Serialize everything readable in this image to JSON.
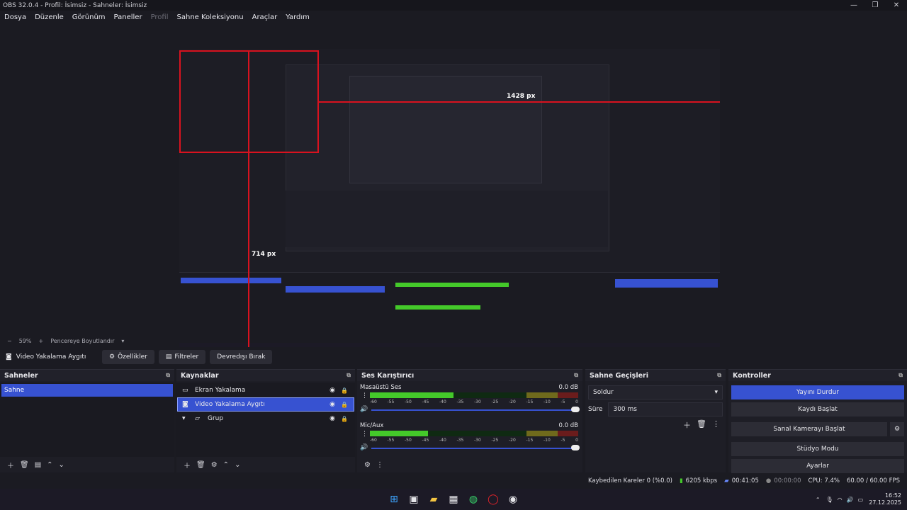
{
  "window": {
    "title": "OBS 32.0.4 - Profil: İsimsiz - Sahneler: İsimsiz",
    "minimize": "—",
    "maximize": "❐",
    "close": "✕"
  },
  "menu": {
    "items": [
      "Dosya",
      "Düzenle",
      "Görünüm",
      "Paneller",
      "Profil",
      "Sahne Koleksiyonu",
      "Araçlar",
      "Yardım"
    ]
  },
  "preview": {
    "label_1428": "1428 px",
    "label_714": "714 px",
    "zoom": "59%",
    "fit_label": "Pencereye Boyutlandır",
    "minus": "−",
    "plus": "+"
  },
  "source_toolbar": {
    "source_name": "Video Yakalama Aygıtı",
    "properties": "Özellikler",
    "filters": "Filtreler",
    "deactivate": "Devredışı Bırak"
  },
  "scenes": {
    "title": "Sahneler",
    "items": [
      "Sahne"
    ]
  },
  "sources": {
    "title": "Kaynaklar",
    "items": [
      "Ekran Yakalama",
      "Video Yakalama Aygıtı",
      "Grup"
    ]
  },
  "mixer": {
    "title": "Ses Karıştırıcı",
    "channels": [
      {
        "name": "Masaüstü Ses",
        "db": "0.0 dB",
        "level_fraction": 0.4
      },
      {
        "name": "Mic/Aux",
        "db": "0.0 dB",
        "level_fraction": 0.28
      }
    ],
    "ticks": [
      "-60",
      "-55",
      "-50",
      "-45",
      "-40",
      "-35",
      "-30",
      "-25",
      "-20",
      "-15",
      "-10",
      "-5",
      "0"
    ]
  },
  "transitions": {
    "title": "Sahne Geçişleri",
    "selected": "Soldur",
    "duration_label": "Süre",
    "duration_value": "300 ms"
  },
  "controls": {
    "title": "Kontroller",
    "buttons": [
      "Yayını Durdur",
      "Kaydı Başlat",
      "Sanal Kamerayı Başlat",
      "Stüdyo Modu",
      "Ayarlar"
    ]
  },
  "status": {
    "dropped": "Kaybedilen Kareler 0 (%0.0)",
    "bitrate": "6205 kbps",
    "stream_time": "00:41:05",
    "record_time": "00:00:00",
    "cpu": "CPU: 7.4%",
    "fps": "60.00 / 60.00 FPS"
  },
  "taskbar": {
    "time": "16:52",
    "date": "27.12.2025"
  },
  "colors": {
    "accent": "#3752d1",
    "background": "#1b1b22",
    "red_line": "#d9121f"
  }
}
